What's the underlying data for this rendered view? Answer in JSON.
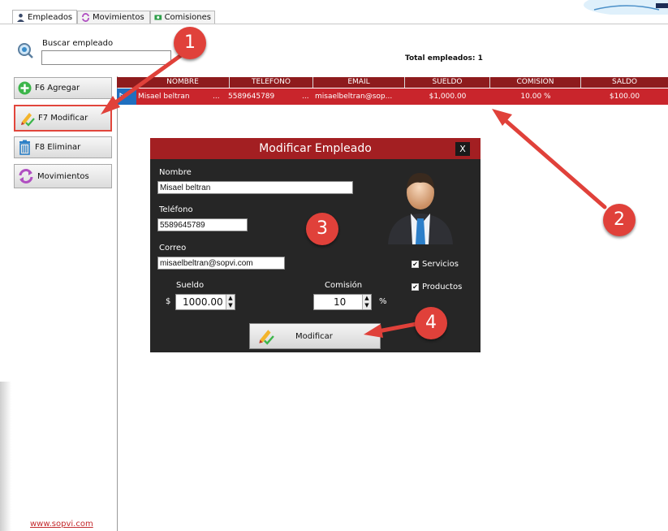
{
  "tabs": [
    {
      "label": "Empleados",
      "icon": "user-icon"
    },
    {
      "label": "Movimientos",
      "icon": "refresh-icon"
    },
    {
      "label": "Comisiones",
      "icon": "money-icon"
    }
  ],
  "search": {
    "label": "Buscar empleado",
    "value": ""
  },
  "total_label": "Total empleados: 1",
  "sidebar": {
    "buttons": [
      {
        "label": "F6 Agregar",
        "icon": "add-icon"
      },
      {
        "label": "F7 Modificar",
        "icon": "pencil-check-icon"
      },
      {
        "label": "F8 Eliminar",
        "icon": "trash-icon"
      },
      {
        "label": "Movimientos",
        "icon": "refresh-icon"
      }
    ]
  },
  "table": {
    "columns": [
      "NOMBRE",
      "TELEFONO",
      "EMAIL",
      "SUELDO",
      "COMISION",
      "SALDO"
    ],
    "rows": [
      {
        "nombre": "Misael beltran",
        "nombre_more": "...",
        "telefono": "5589645789",
        "telefono_more": "...",
        "email": "misaelbeltran@sop...",
        "sueldo": "$1,000.00",
        "comision": "10.00 %",
        "saldo": "$100.00"
      }
    ]
  },
  "dialog": {
    "title": "Modificar Empleado",
    "close": "X",
    "nombre_label": "Nombre",
    "nombre_value": "Misael beltran",
    "telefono_label": "Teléfono",
    "telefono_value": "5589645789",
    "correo_label": "Correo",
    "correo_value": "misaelbeltran@sopvi.com",
    "sueldo_label": "Sueldo",
    "sueldo_prefix": "$",
    "sueldo_value": "1000.00",
    "comision_label": "Comisión",
    "comision_value": "10",
    "comision_suffix": "%",
    "servicios_label": "Servicios",
    "servicios_checked": true,
    "productos_label": "Productos",
    "productos_checked": true,
    "submit_label": "Modificar"
  },
  "annotations": [
    "1",
    "2",
    "3",
    "4"
  ],
  "footer": {
    "link": "www.sopvi.com"
  },
  "colors": {
    "header_red": "#8e1b1d",
    "row_red": "#c9252c",
    "dialog_title": "#a31f22",
    "dialog_bg": "#262626",
    "annotation": "#e0413a"
  }
}
